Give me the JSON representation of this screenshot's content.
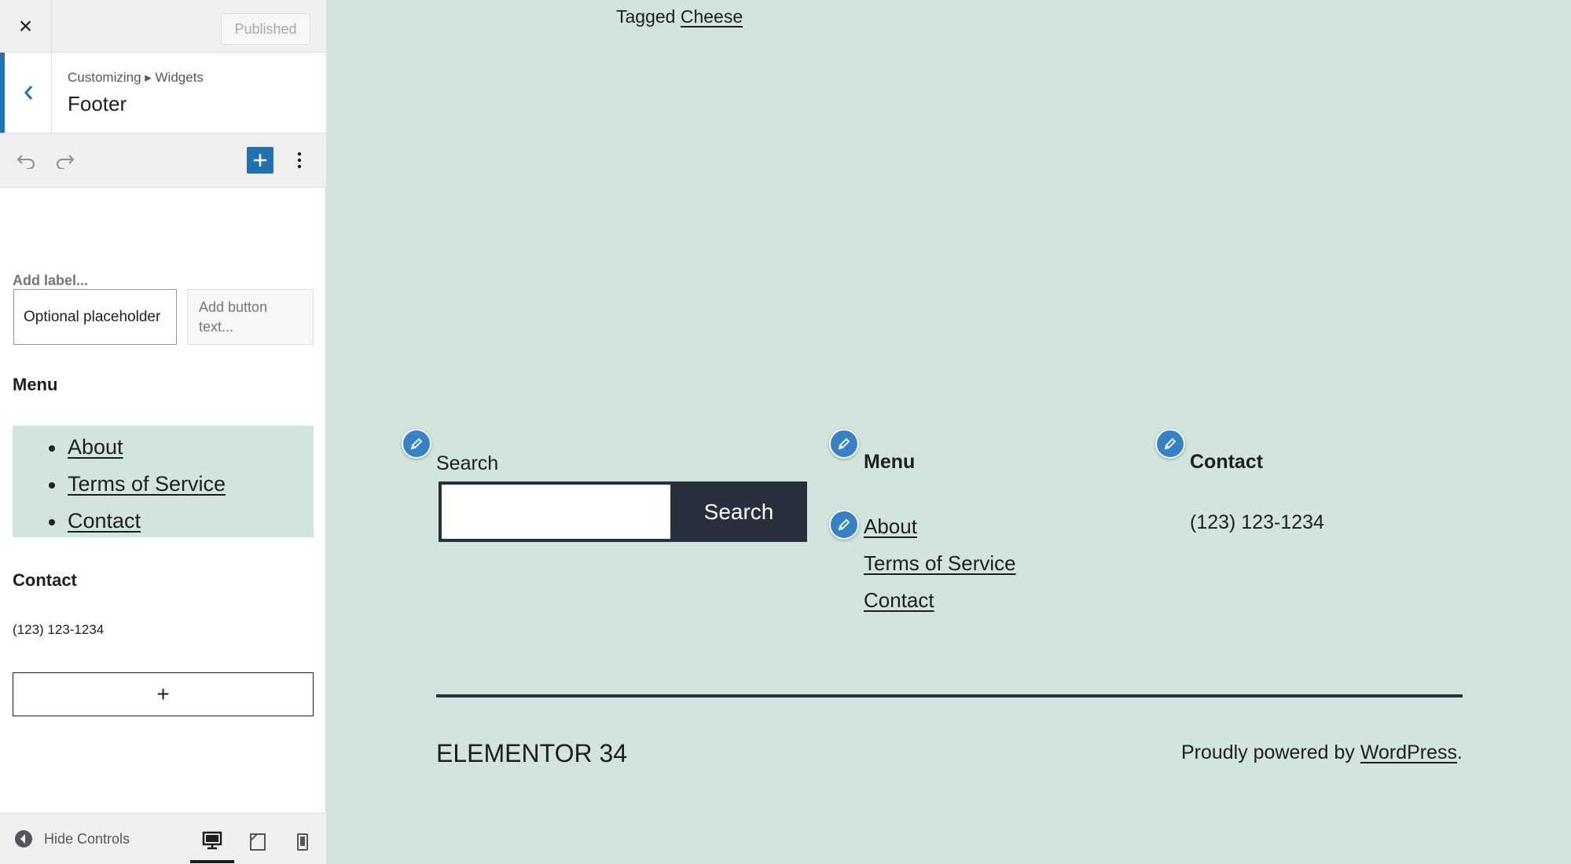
{
  "customizer": {
    "close_label": "×",
    "publish_label": "Published",
    "breadcrumb": "Customizing ▸ Widgets",
    "panel_title": "Footer",
    "search_widget": {
      "label_placeholder": "Add label...",
      "placeholder_value": "Optional placeholder",
      "button_text_placeholder": "Add button text..."
    },
    "menu_widget": {
      "title": "Menu",
      "items": [
        "About",
        "Terms of Service",
        "Contact"
      ]
    },
    "contact_widget": {
      "title": "Contact",
      "phone": "(123) 123-1234"
    },
    "add_block_label": "+",
    "hide_controls_label": "Hide Controls",
    "devices": [
      "desktop-icon",
      "tablet-icon",
      "mobile-icon"
    ],
    "active_device": "desktop",
    "accent_color": "#2271b1"
  },
  "preview": {
    "tagged_prefix": "Tagged",
    "tagged_link": "Cheese",
    "search": {
      "label": "Search",
      "button_label": "Search"
    },
    "menu": {
      "title": "Menu",
      "items": [
        "About",
        "Terms of Service",
        "Contact"
      ]
    },
    "contact": {
      "title": "Contact",
      "phone": "(123) 123-1234"
    },
    "site_name": "ELEMENTOR 34",
    "powered_prefix": "Proudly powered by",
    "powered_link": "WordPress",
    "powered_suffix": ".",
    "background_color": "#d1e4dd"
  }
}
